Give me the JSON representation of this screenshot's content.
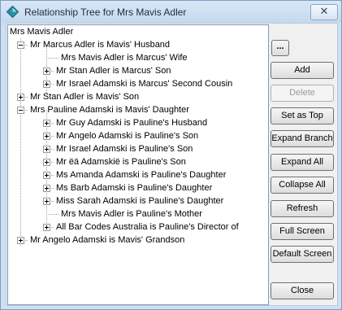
{
  "window": {
    "title": "Relationship Tree for Mrs Mavis Adler"
  },
  "tree": {
    "root": "Mrs Mavis Adler",
    "items": [
      "Mr Marcus Adler is Mavis' Husband",
      "Mrs Mavis Adler is Marcus' Wife",
      "Mr Stan Adler is Marcus' Son",
      "Mr Israel Adamski is Marcus' Second Cousin",
      "Mr Stan Adler is Mavis' Son",
      "Mrs Pauline Adamski is Mavis' Daughter",
      "Mr Guy Adamski is Pauline's Husband",
      "Mr Angelo Adamski is Pauline's Son",
      "Mr Israel Adamski is Pauline's Son",
      "Mr ëä Adamskië is Pauline's Son",
      "Ms Amanda Adamski is Pauline's Daughter",
      "Ms Barb Adamski is Pauline's Daughter",
      "Miss Sarah Adamski is Pauline's Daughter",
      "Mrs Mavis Adler is Pauline's Mother",
      "All Bar Codes Australia is Pauline's Director of",
      "Mr Angelo Adamski is Mavis' Grandson"
    ]
  },
  "buttons": {
    "browse": "...",
    "add": "Add",
    "delete": "Delete",
    "set_as_top": "Set as Top",
    "expand_branch": "Expand Branch",
    "expand_all": "Expand All",
    "collapse_all": "Collapse All",
    "refresh": "Refresh",
    "full_screen": "Full Screen",
    "default_screen": "Default Screen",
    "close": "Close"
  }
}
